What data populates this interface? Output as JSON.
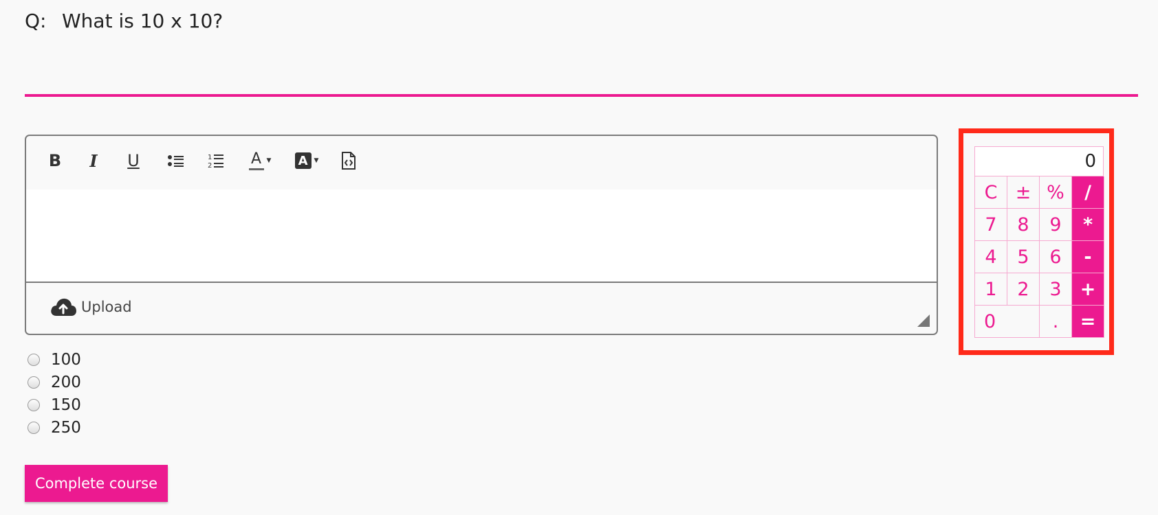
{
  "question": {
    "prefix": "Q:",
    "text": "What is 10 x 10?"
  },
  "colors": {
    "accent": "#ec1a90",
    "highlight_border": "#ff2a1a"
  },
  "editor": {
    "toolbar": [
      {
        "name": "bold-button",
        "icon": "bold-icon",
        "glyph": "B"
      },
      {
        "name": "italic-button",
        "icon": "italic-icon",
        "glyph": "I"
      },
      {
        "name": "underline-button",
        "icon": "underline-icon",
        "glyph": "U"
      },
      {
        "name": "bullet-list-button",
        "icon": "bullet-list-icon"
      },
      {
        "name": "numbered-list-button",
        "icon": "numbered-list-icon"
      },
      {
        "name": "font-color-button",
        "icon": "font-color-icon",
        "glyph": "A"
      },
      {
        "name": "highlight-color-button",
        "icon": "highlight-icon",
        "glyph": "A"
      },
      {
        "name": "source-code-button",
        "icon": "source-code-icon"
      }
    ],
    "upload_label": "Upload",
    "upload_icon": "cloud-upload-icon"
  },
  "options": [
    "100",
    "200",
    "150",
    "250"
  ],
  "complete_button": "Complete course",
  "calculator": {
    "display": "0",
    "keys": [
      {
        "label": "C",
        "type": "func"
      },
      {
        "label": "±",
        "type": "func"
      },
      {
        "label": "%",
        "type": "func"
      },
      {
        "label": "/",
        "type": "op"
      },
      {
        "label": "7",
        "type": "num"
      },
      {
        "label": "8",
        "type": "num"
      },
      {
        "label": "9",
        "type": "num"
      },
      {
        "label": "*",
        "type": "op"
      },
      {
        "label": "4",
        "type": "num"
      },
      {
        "label": "5",
        "type": "num"
      },
      {
        "label": "6",
        "type": "num"
      },
      {
        "label": "-",
        "type": "op"
      },
      {
        "label": "1",
        "type": "num"
      },
      {
        "label": "2",
        "type": "num"
      },
      {
        "label": "3",
        "type": "num"
      },
      {
        "label": "+",
        "type": "op"
      },
      {
        "label": "0",
        "type": "zero"
      },
      {
        "label": ".",
        "type": "num"
      },
      {
        "label": "=",
        "type": "op"
      }
    ]
  }
}
